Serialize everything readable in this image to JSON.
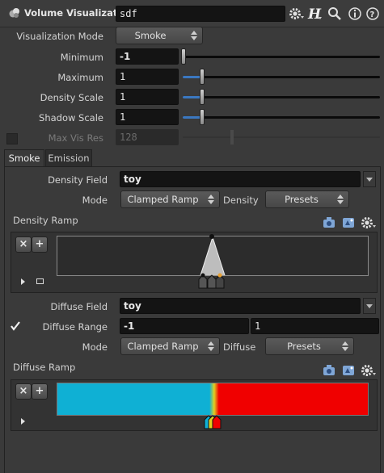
{
  "header": {
    "node_type": "Volume Visualization",
    "node_name": "sdf",
    "icons": [
      "gear-icon",
      "houdini-help-icon",
      "search-icon",
      "info-icon",
      "help-icon"
    ]
  },
  "params": {
    "viz_mode_label": "Visualization Mode",
    "viz_mode_value": "Smoke",
    "minimum_label": "Minimum",
    "minimum_value": "-1",
    "maximum_label": "Maximum",
    "maximum_value": "1",
    "density_scale_label": "Density Scale",
    "density_scale_value": "1",
    "shadow_scale_label": "Shadow Scale",
    "shadow_scale_value": "1",
    "max_vis_res_label": "Max Vis Res",
    "max_vis_res_value": "128"
  },
  "tabs": [
    {
      "label": "Smoke",
      "active": true
    },
    {
      "label": "Emission",
      "active": false
    }
  ],
  "smoke": {
    "density_field_label": "Density Field",
    "density_field_value": "toy",
    "mode_label": "Mode",
    "mode_value": "Clamped Ramp",
    "density_label": "Density",
    "density_presets": "Presets",
    "density_ramp_label": "Density Ramp",
    "diffuse_field_label": "Diffuse Field",
    "diffuse_field_value": "toy",
    "diffuse_range_label": "Diffuse Range",
    "diffuse_range_min": "-1",
    "diffuse_range_max": "1",
    "diffuse_mode_label": "Mode",
    "diffuse_mode_value": "Clamped Ramp",
    "diffuse_label": "Diffuse",
    "diffuse_presets": "Presets",
    "diffuse_ramp_label": "Diffuse Ramp",
    "remove_key_symbol": "×",
    "add_key_symbol": "+"
  },
  "slider_levels": {
    "minimum": 0.0,
    "maximum": 0.1,
    "density_scale": 0.1,
    "shadow_scale": 0.1
  },
  "colors": {
    "accent_blue": "#3b78c0",
    "ramp_cyan": "#0fb0d4",
    "ramp_red": "#f00000",
    "key_orange": "#e8a030"
  }
}
